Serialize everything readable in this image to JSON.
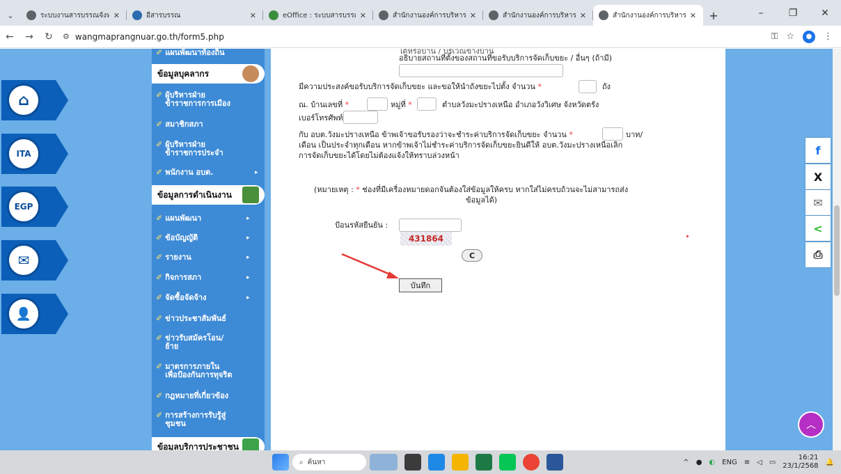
{
  "browser": {
    "tabs": [
      {
        "title": "ระบบงานสารบรรณจังหวัดตรัง",
        "active": false
      },
      {
        "title": "อีสารบรรณ",
        "active": false
      },
      {
        "title": "eOffice : ระบบสารบรรณอิเล็กฯ",
        "active": false
      },
      {
        "title": "สำนักงานองค์การบริหารส่วนตำ",
        "active": false
      },
      {
        "title": "สำนักงานองค์การบริหารส่วนตำ",
        "active": false
      },
      {
        "title": "สำนักงานองค์การบริหารส่วนตำ",
        "active": true
      }
    ],
    "url": "wangmaprangnuar.go.th/form5.php"
  },
  "sidebar": {
    "top_cut": "แผนพัฒนาท้องถิ่น",
    "personnel_heading": "ข้อมูลบุคลากร",
    "personnel_items": [
      {
        "label": "ผู้บริหารฝ่าย\nข้าราชการการเมือง",
        "arrow": false
      },
      {
        "label": "สมาชิกสภา",
        "arrow": false
      },
      {
        "label": "ผู้บริหารฝ่าย\nข้าราชการประจำ",
        "arrow": false
      },
      {
        "label": "พนักงาน อบต.",
        "arrow": true
      }
    ],
    "operations_heading": "ข้อมูลการดำเนินงาน",
    "operations_items": [
      {
        "label": "แผนพัฒนา",
        "arrow": true
      },
      {
        "label": "ข้อบัญญัติ",
        "arrow": true
      },
      {
        "label": "รายงาน",
        "arrow": true
      },
      {
        "label": "กิจการสภา",
        "arrow": true
      },
      {
        "label": "จัดซื้อจัดจ้าง",
        "arrow": true
      },
      {
        "label": "ข่าวประชาสัมพันธ์",
        "arrow": false
      },
      {
        "label": "ข่าวรับสมัครโอน/\nย้าย",
        "arrow": false
      },
      {
        "label": "มาตรการภายใน\nเพื่อป้องกันการทุจริต",
        "arrow": false
      },
      {
        "label": "กฎหมายที่เกี่ยวข้อง",
        "arrow": false
      },
      {
        "label": "การสร้างการรับรู้สู่\nชุมชน",
        "arrow": false
      }
    ],
    "bottom_heading": "ข้อมูลบริการประชาชน"
  },
  "left_buttons": [
    {
      "name": "home",
      "label": "⌂"
    },
    {
      "name": "ita",
      "label": "ITA"
    },
    {
      "name": "egp",
      "label": "EGP"
    },
    {
      "name": "mail",
      "label": "✉"
    },
    {
      "name": "user",
      "label": "👤"
    }
  ],
  "form": {
    "top_cut": "ใต้หรือบ้าน / บริเวณข้างบ้าน",
    "location_label": "อธิบายสถานที่ตั้งของสถานที่ขอรับบริการจัดเก็บขยะ / อื่นๆ (ถ้ามี)",
    "line1_a": "มีความประสงค์ขอรับบริการจัดเก็บขยะ และขอให้นำถังขยะไปตั้ง จำนวน",
    "line1_b": "ถัง",
    "line2_a": "ณ. บ้านเลขที่",
    "line2_b": "หมู่ที่",
    "line2_c": "ตำบลวังมะปรางเหนือ อำเภอวังวิเศษ จังหวัดตรัง",
    "line3": "เบอร์โทรศัพท์",
    "line4_a": "กับ อบต.วังมะปรางเหนือ ข้าพเจ้าขอรับรองว่าจะชำระค่าบริการจัดเก็บขยะ จำนวน",
    "line4_b": "บาท/",
    "line5": "เดือน เป็นประจำทุกเดือน หากข้าพเจ้าไม่ชำระค่าบริการจัดเก็บขยะยินดีให้ อบต.วังมะปรางเหนือเลิก",
    "line6": "การจัดเก็บขยะได้โดยไม่ต้องแจ้งให้ทราบล่วงหน้า",
    "note_a": "(หมายเหตุ :",
    "note_b": "ช่องที่มีเครื่องหมายดอกจันต้องใส่ข้อมูลให้ครบ หากใส่ไม่ครบถ้วนจะไม่สามารถส่ง",
    "note_c": "ข้อมูลได้)",
    "captcha_label": "ป้อนรหัสยืนยัน :",
    "captcha_code": "431864",
    "refresh": "C",
    "submit": "บันทึก",
    "asterisk": "*"
  },
  "socials": [
    {
      "name": "facebook",
      "glyph": "f",
      "color": "#1877f2"
    },
    {
      "name": "x",
      "glyph": "X",
      "color": "#111111"
    },
    {
      "name": "email",
      "glyph": "✉",
      "color": "#666666"
    },
    {
      "name": "share",
      "glyph": "<",
      "color": "#2eb82e"
    },
    {
      "name": "print",
      "glyph": "⎙",
      "color": "#222222"
    }
  ],
  "taskbar": {
    "search": "ค้นหา",
    "lang": "ENG",
    "time": "16:21",
    "date": "23/1/2568"
  },
  "colors": {
    "sidebar": "#3d8ad6",
    "background": "#6aaee9",
    "accent": "#e33",
    "captcha": "#c62828"
  }
}
